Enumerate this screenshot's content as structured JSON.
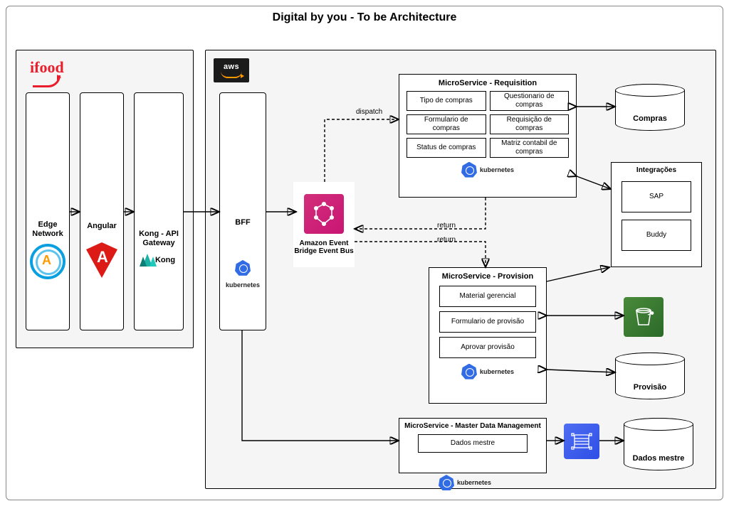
{
  "title": "Digital by you - To be Architecture",
  "ifood": {
    "logo_text": "ifood"
  },
  "aws": {
    "logo_text": "aws"
  },
  "frontend": {
    "edge": {
      "label": "Edge Network"
    },
    "angular": {
      "label": "Angular"
    },
    "kong": {
      "label": "Kong - API Gateway",
      "brand": "Kong"
    }
  },
  "bff": {
    "label": "BFF",
    "runtime": "kubernetes"
  },
  "eventbridge": {
    "label": "Amazon Event Bridge Event Bus"
  },
  "connectors": {
    "dispatch": "dispatch",
    "return1": "return",
    "return2": "return"
  },
  "ms_requisition": {
    "title": "MicroService - Requisition",
    "items": [
      "Tipo de compras",
      "Questionario de compras",
      "Formulario de compras",
      "Requisição de compras",
      "Status de compras",
      "Matriz contabil de compras"
    ],
    "runtime": "kubernetes"
  },
  "ms_provision": {
    "title": "MicroService - Provision",
    "items": [
      "Material gerencial",
      "Formulario de provisão",
      "Aprovar provisão"
    ],
    "runtime": "kubernetes"
  },
  "ms_mdm": {
    "title": "MicroService - Master Data Management",
    "items": [
      "Dados mestre"
    ],
    "runtime": "kubernetes"
  },
  "integrations": {
    "title": "Integrações",
    "items": [
      "SAP",
      "Buddy"
    ]
  },
  "databases": {
    "compras": "Compras",
    "provisao": "Provisão",
    "mdm": "Dados mestre"
  }
}
